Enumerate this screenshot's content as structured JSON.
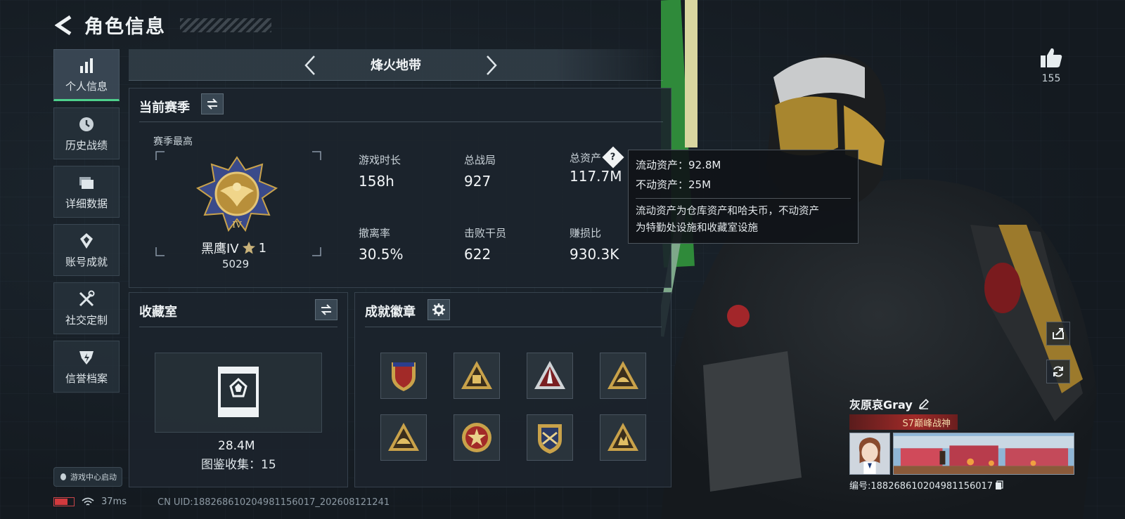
{
  "header": {
    "title": "角色信息"
  },
  "nav": {
    "items": [
      {
        "label": "个人信息",
        "icon": "bar-chart-icon",
        "active": true
      },
      {
        "label": "历史战绩",
        "icon": "clock-icon",
        "active": false
      },
      {
        "label": "详细数据",
        "icon": "folder-icon",
        "active": false
      },
      {
        "label": "账号成就",
        "icon": "achievement-icon",
        "active": false
      },
      {
        "label": "社交定制",
        "icon": "tools-icon",
        "active": false
      },
      {
        "label": "信誉档案",
        "icon": "credit-badge-icon",
        "active": false
      }
    ],
    "game_center": "游戏中心启动"
  },
  "mode": {
    "name": "烽火地带"
  },
  "season": {
    "title": "当前赛季",
    "best_label": "赛季最高",
    "rank_name": "黑鹰IV",
    "rank_stars": "1",
    "rank_score": "5029",
    "stats": [
      {
        "label": "游戏时长",
        "value": "158h"
      },
      {
        "label": "总战局",
        "value": "927"
      },
      {
        "label": "总资产",
        "value": "117.7M"
      },
      {
        "label": "撤离率",
        "value": "30.5%"
      },
      {
        "label": "击败干员",
        "value": "622"
      },
      {
        "label": "赚损比",
        "value": "930.3K"
      }
    ]
  },
  "tooltip": {
    "liquid": "流动资产：92.8M",
    "fixed": "不动资产：25M",
    "desc_line1": "流动资产为仓库资产和哈夫币，不动资产",
    "desc_line2": "为特勤处设施和收藏室设施"
  },
  "collection": {
    "title": "收藏室",
    "value": "28.4M",
    "count": "图鉴收集：15"
  },
  "badges": {
    "title": "成就徽章",
    "items": [
      "shield-badge",
      "triangle-badge-1",
      "triangle-badge-2",
      "triangle-badge-3",
      "triangle-badge-4",
      "star-badge",
      "crest-badge",
      "triangle-badge-5"
    ]
  },
  "profile": {
    "likes": "155",
    "name": "灰原哀Gray",
    "title_tag": "S7巅峰战神",
    "id_text": "编号:18826861020498115601​7"
  },
  "status": {
    "ping": "37ms",
    "uid": "CN UID:188268610204981156017_202608121241"
  },
  "colors": {
    "accent_green": "#4ed08c",
    "panel_bg": "#1c242c",
    "tag_red": "#a02a28",
    "gold": "#c9a24a"
  }
}
